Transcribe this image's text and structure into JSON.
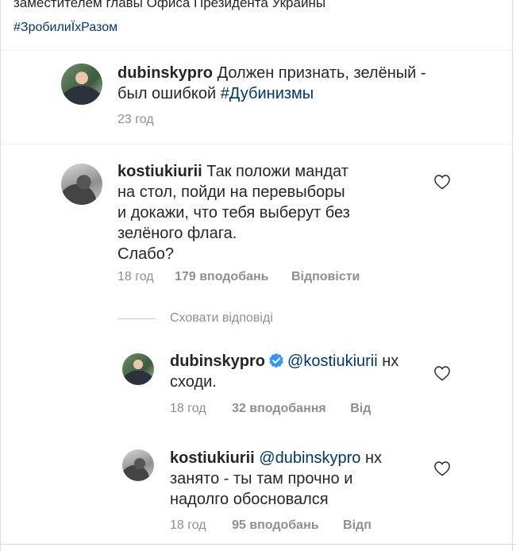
{
  "caption": {
    "text": "заместителем главы Офиса Президента Украины",
    "hashtag": "#ЗробилиЇхРазом"
  },
  "comments": [
    {
      "username": "dubinskypro",
      "text": " Должен признать, зелёный - был ошибкой ",
      "hashtag": "#Дубинизмы",
      "time": "23 год"
    },
    {
      "username": "kostiukiurii",
      "text_lines": [
        " Так положи мандат",
        "на стол,  пойди на перевыборы",
        "и докажи, что тебя выберут без",
        "зелёного флага.",
        "Слабо?"
      ],
      "time": "18 год",
      "likes": "179 вподобань",
      "reply": "Відповісти"
    }
  ],
  "replies_toggle": "Сховати відповіді",
  "replies": [
    {
      "username": "dubinskypro",
      "mention": "@kostiukiurii",
      "text_lines": [
        " нх",
        "сходи."
      ],
      "time": "18 год",
      "likes": "32 вподобання",
      "reply": "Від"
    },
    {
      "username": "kostiukiurii",
      "mention": "@dubinskypro",
      "text_lines": [
        " нх",
        "занято - ты там прочно и",
        "надолго обосновался"
      ],
      "time": "18 год",
      "likes": "95 вподобань",
      "reply": "Відп"
    }
  ],
  "icons": {
    "heart": "heart-outline-icon",
    "verified": "verified-badge-icon"
  },
  "colors": {
    "link": "#00376b",
    "verified": "#3897f0",
    "meta": "#8e8e8e"
  }
}
